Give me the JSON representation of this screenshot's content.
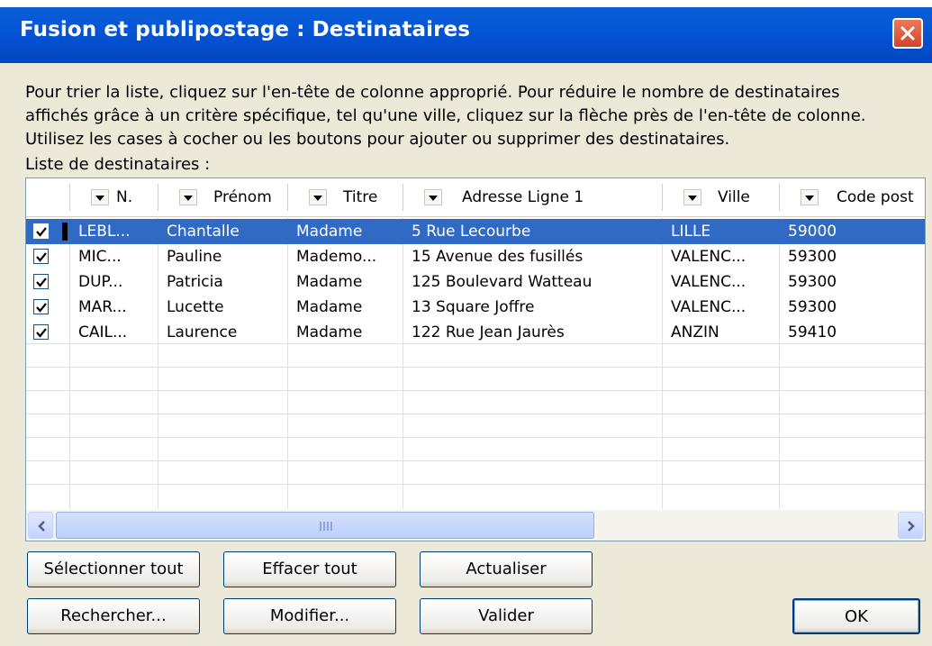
{
  "window": {
    "title": "Fusion et publipostage : Destinataires"
  },
  "description": [
    "Pour trier la liste, cliquez sur l'en-tête de colonne approprié. Pour réduire le nombre de destinataires",
    "affichés grâce à un critère spécifique, tel qu'une ville, cliquez sur la flèche près de l'en-tête de colonne.",
    "Utilisez les cases à cocher ou les boutons pour ajouter ou supprimer des destinataires."
  ],
  "list_label": "Liste de destinataires :",
  "columns": [
    "N.",
    "Prénom",
    "Titre",
    "Adresse Ligne 1",
    "Ville",
    "Code post"
  ],
  "rows": [
    {
      "checked": true,
      "nom": "LEBL...",
      "prenom": "Chantalle",
      "titre": "Madame",
      "adresse": "5 Rue Lecourbe",
      "ville": "LILLE",
      "code": "59000",
      "selected": true
    },
    {
      "checked": true,
      "nom": "MIC...",
      "prenom": "Pauline",
      "titre": "Mademo...",
      "adresse": "15 Avenue des fusillés",
      "ville": "VALENC...",
      "code": "59300",
      "selected": false
    },
    {
      "checked": true,
      "nom": "DUP...",
      "prenom": "Patricia",
      "titre": "Madame",
      "adresse": "125 Boulevard Watteau",
      "ville": "VALENC...",
      "code": "59300",
      "selected": false
    },
    {
      "checked": true,
      "nom": "MAR...",
      "prenom": "Lucette",
      "titre": "Madame",
      "adresse": "13 Square Joffre",
      "ville": "VALENC...",
      "code": "59300",
      "selected": false
    },
    {
      "checked": true,
      "nom": "CAIL...",
      "prenom": "Laurence",
      "titre": "Madame",
      "adresse": "122 Rue Jean Jaurès",
      "ville": "ANZIN",
      "code": "59410",
      "selected": false
    }
  ],
  "buttons": {
    "select_all": "Sélectionner tout",
    "clear_all": "Effacer tout",
    "refresh": "Actualiser",
    "find": "Rechercher...",
    "edit": "Modifier...",
    "validate": "Valider",
    "ok": "OK"
  },
  "colors": {
    "titlebar": "#0453d4",
    "selection": "#316ac5",
    "dialog_bg": "#ece9d8"
  }
}
